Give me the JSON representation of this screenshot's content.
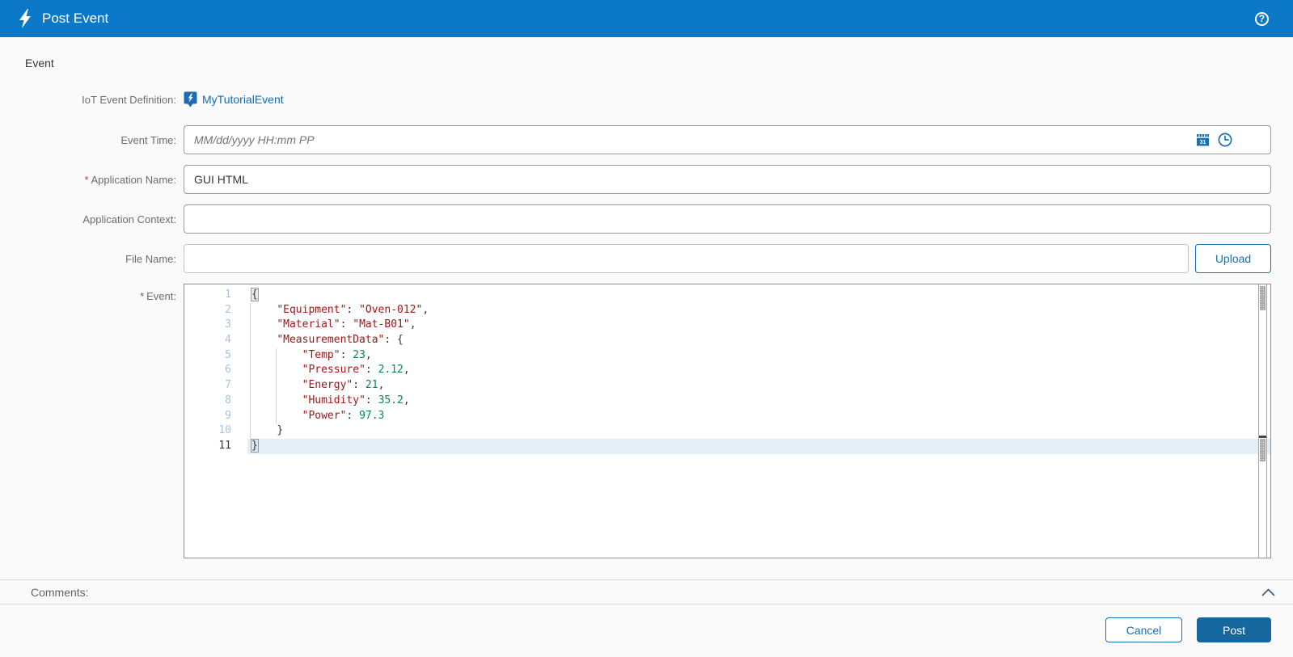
{
  "header": {
    "title": "Post Event"
  },
  "section_title": "Event",
  "form": {
    "iot_event_definition": {
      "label": "IoT Event Definition:",
      "value": "MyTutorialEvent"
    },
    "event_time": {
      "label": "Event Time:",
      "placeholder": "MM/dd/yyyy HH:mm PP",
      "value": ""
    },
    "application_name": {
      "label": "Application Name:",
      "required": "*",
      "value": "GUI HTML"
    },
    "application_context": {
      "label": "Application Context:",
      "value": ""
    },
    "file_name": {
      "label": "File Name:",
      "value": "",
      "upload_label": "Upload"
    },
    "event_field": {
      "label": "Event:",
      "required": "*"
    }
  },
  "editor": {
    "active_line": 11,
    "lines": [
      {
        "num": 1,
        "segments": [
          {
            "text": "{",
            "cls": "brace matched"
          }
        ]
      },
      {
        "num": 2,
        "segments": [
          {
            "text": "    ",
            "cls": "ws"
          },
          {
            "text": "\"Equipment\"",
            "cls": "key"
          },
          {
            "text": ": ",
            "cls": "punct"
          },
          {
            "text": "\"Oven-012\"",
            "cls": "str"
          },
          {
            "text": ",",
            "cls": "punct"
          }
        ]
      },
      {
        "num": 3,
        "segments": [
          {
            "text": "    ",
            "cls": "ws"
          },
          {
            "text": "\"Material\"",
            "cls": "key"
          },
          {
            "text": ": ",
            "cls": "punct"
          },
          {
            "text": "\"Mat-B01\"",
            "cls": "str"
          },
          {
            "text": ",",
            "cls": "punct"
          }
        ]
      },
      {
        "num": 4,
        "segments": [
          {
            "text": "    ",
            "cls": "ws"
          },
          {
            "text": "\"MeasurementData\"",
            "cls": "key"
          },
          {
            "text": ": ",
            "cls": "punct"
          },
          {
            "text": "{",
            "cls": "brace"
          }
        ]
      },
      {
        "num": 5,
        "segments": [
          {
            "text": "        ",
            "cls": "ws"
          },
          {
            "text": "\"Temp\"",
            "cls": "key"
          },
          {
            "text": ": ",
            "cls": "punct"
          },
          {
            "text": "23",
            "cls": "num"
          },
          {
            "text": ",",
            "cls": "punct"
          }
        ]
      },
      {
        "num": 6,
        "segments": [
          {
            "text": "        ",
            "cls": "ws"
          },
          {
            "text": "\"Pressure\"",
            "cls": "key"
          },
          {
            "text": ": ",
            "cls": "punct"
          },
          {
            "text": "2.12",
            "cls": "num"
          },
          {
            "text": ",",
            "cls": "punct"
          }
        ]
      },
      {
        "num": 7,
        "segments": [
          {
            "text": "        ",
            "cls": "ws"
          },
          {
            "text": "\"Energy\"",
            "cls": "key"
          },
          {
            "text": ": ",
            "cls": "punct"
          },
          {
            "text": "21",
            "cls": "num"
          },
          {
            "text": ",",
            "cls": "punct"
          }
        ]
      },
      {
        "num": 8,
        "segments": [
          {
            "text": "        ",
            "cls": "ws"
          },
          {
            "text": "\"Humidity\"",
            "cls": "key"
          },
          {
            "text": ": ",
            "cls": "punct"
          },
          {
            "text": "35.2",
            "cls": "num"
          },
          {
            "text": ",",
            "cls": "punct"
          }
        ]
      },
      {
        "num": 9,
        "segments": [
          {
            "text": "        ",
            "cls": "ws"
          },
          {
            "text": "\"Power\"",
            "cls": "key"
          },
          {
            "text": ": ",
            "cls": "punct"
          },
          {
            "text": "97.3",
            "cls": "num"
          }
        ]
      },
      {
        "num": 10,
        "segments": [
          {
            "text": "    ",
            "cls": "ws"
          },
          {
            "text": "}",
            "cls": "brace"
          }
        ]
      },
      {
        "num": 11,
        "segments": [
          {
            "text": "}",
            "cls": "brace matched"
          }
        ]
      }
    ]
  },
  "comments": {
    "label": "Comments:"
  },
  "footer": {
    "cancel_label": "Cancel",
    "post_label": "Post"
  },
  "colors": {
    "header_bg": "#0b79c7",
    "link_blue": "#0f6cbd",
    "button_blue": "#1a6fae",
    "primary_button_bg": "#15679d",
    "required_red": "#a9423f",
    "syntax_key": "#a31515",
    "syntax_number": "#098658",
    "active_line_bg": "#e3eef7",
    "line_number": "#a6c3dd"
  }
}
